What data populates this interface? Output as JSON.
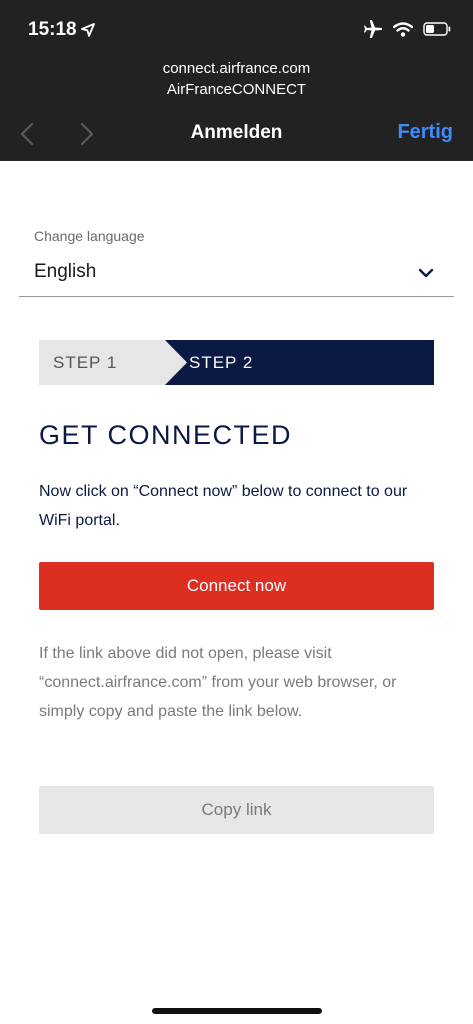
{
  "status_bar": {
    "time": "15:18",
    "icons": [
      "location-arrow-icon",
      "airplane-icon",
      "wifi-icon",
      "battery-icon"
    ]
  },
  "browser": {
    "domain": "connect.airfrance.com",
    "site_title": "AirFranceCONNECT",
    "page_title": "Anmelden",
    "done_label": "Fertig",
    "accent_color": "#3d8bfd"
  },
  "language": {
    "label": "Change language",
    "selected": "English"
  },
  "steps": [
    {
      "label": "STEP 1",
      "active": false
    },
    {
      "label": "STEP 2",
      "active": true
    }
  ],
  "main": {
    "headline": "GET CONNECTED",
    "intro": "Now click on “Connect now” below to connect to our WiFi portal.",
    "connect_label": "Connect now",
    "help_text": "If the link above did not open, please visit “connect.airfrance.com” from your web browser, or simply copy and paste the link below.",
    "copy_label": "Copy link"
  },
  "colors": {
    "brand_navy": "#0b1a45",
    "connect_red": "#dc2e21",
    "chrome_dark": "#222222"
  }
}
